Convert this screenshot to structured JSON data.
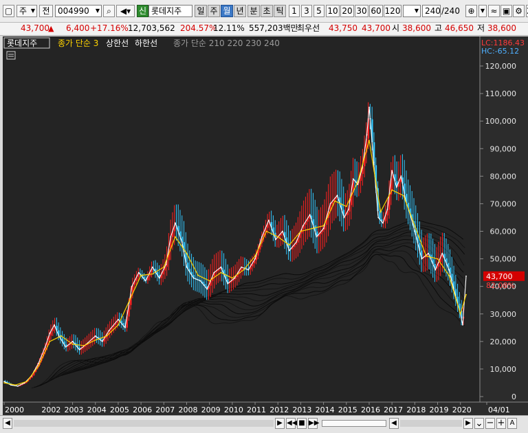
{
  "toolbar": {
    "market_label": "주",
    "market_btn": "전",
    "code": "004990",
    "new_badge": "신",
    "stock_name": "롯데지주",
    "periods": [
      "일",
      "주",
      "월",
      "년",
      "분",
      "초",
      "틱"
    ],
    "selected_period": "월",
    "counts": [
      "1",
      "3",
      "5",
      "10",
      "20",
      "30",
      "60",
      "120"
    ],
    "bar_count": "240",
    "bar_total": "/240",
    "right_partial": "20"
  },
  "quote": {
    "price": "43,700",
    "arrow": "▲",
    "change": "6,400",
    "change_pct": "+17.16%",
    "volume": "12,703,562",
    "volume_ratio": "204.57%",
    "turnover": "12.11%",
    "amount": "557,203백만",
    "best_label": "최우선",
    "best_price": "43,750",
    "ask_price": "43,700",
    "open_label": "시",
    "open": "38,600",
    "high_label": "고",
    "high": "46,650",
    "low_label": "저",
    "low": "38,600"
  },
  "legend": {
    "stock_name": "롯데지주",
    "price_ma": "종가 단순 3",
    "upper": "상한선",
    "lower": "하한선",
    "ma_group": "종가 단순 210 220 230 240"
  },
  "chart_data": {
    "type": "line",
    "title": "롯데지주",
    "x_ticks": [
      "2000",
      "2002",
      "2003",
      "2004",
      "2005",
      "2006",
      "2007",
      "2008",
      "2009",
      "2010",
      "2011",
      "2012",
      "2013",
      "2014",
      "2015",
      "2016",
      "2017",
      "2018",
      "2019",
      "2020",
      "04/01"
    ],
    "y_ticks": [
      0,
      10000,
      20000,
      30000,
      40000,
      50000,
      60000,
      70000,
      80000,
      90000,
      100000,
      110000,
      120000
    ],
    "y_tick_labels": [
      "0",
      "10,000",
      "20,000",
      "30,000",
      "40,000",
      "50,000",
      "60,000",
      "70,000",
      "80,000",
      "90,000",
      "100,000",
      "110,000",
      "120,000"
    ],
    "ylim": [
      0,
      125000
    ],
    "xlim": [
      2000.0,
      2020.25
    ],
    "grid": false,
    "lc_label": "LC:1186.43",
    "hc_label": "HC:-65.12",
    "current_price": "43,700",
    "current_pct": "82.08%",
    "current_value": 43700,
    "series": [
      {
        "name": "종가",
        "x": [
          2000.0,
          2000.3,
          2000.6,
          2000.9,
          2001.2,
          2001.5,
          2001.8,
          2002.0,
          2002.2,
          2002.4,
          2002.7,
          2003.0,
          2003.3,
          2003.6,
          2004.0,
          2004.3,
          2004.6,
          2005.0,
          2005.3,
          2005.6,
          2005.9,
          2006.2,
          2006.5,
          2006.8,
          2007.1,
          2007.3,
          2007.5,
          2007.8,
          2008.0,
          2008.3,
          2008.6,
          2008.9,
          2009.2,
          2009.5,
          2009.8,
          2010.1,
          2010.4,
          2010.7,
          2011.0,
          2011.3,
          2011.6,
          2011.9,
          2012.2,
          2012.5,
          2012.8,
          2013.1,
          2013.4,
          2013.7,
          2014.0,
          2014.3,
          2014.6,
          2014.9,
          2015.1,
          2015.3,
          2015.5,
          2015.7,
          2015.9,
          2016.0,
          2016.2,
          2016.4,
          2016.6,
          2016.8,
          2017.0,
          2017.2,
          2017.4,
          2017.6,
          2017.8,
          2018.0,
          2018.3,
          2018.6,
          2018.9,
          2019.2,
          2019.5,
          2019.8,
          2020.0,
          2020.1,
          2020.25
        ],
        "y": [
          5500,
          4200,
          3800,
          5000,
          7500,
          12000,
          18000,
          23000,
          26000,
          22000,
          18000,
          20000,
          17000,
          19000,
          22000,
          20000,
          24000,
          28000,
          25000,
          40000,
          45000,
          42000,
          47000,
          43000,
          48000,
          58000,
          63000,
          56000,
          47000,
          43000,
          42000,
          39000,
          45000,
          47000,
          41000,
          43000,
          47000,
          46000,
          50000,
          58000,
          64000,
          57000,
          60000,
          53000,
          56000,
          62000,
          66000,
          58000,
          61000,
          70000,
          73000,
          65000,
          68000,
          79000,
          77000,
          83000,
          95000,
          105000,
          85000,
          65000,
          63000,
          68000,
          82000,
          76000,
          80000,
          71000,
          66000,
          60000,
          50000,
          52000,
          46000,
          52000,
          46000,
          36000,
          30000,
          26000,
          43700
        ],
        "color": "#ffffff"
      },
      {
        "name": "종가 단순 3",
        "x": [
          2000.0,
          2000.5,
          2001.0,
          2001.5,
          2002.0,
          2002.5,
          2003.0,
          2003.5,
          2004.0,
          2004.5,
          2005.0,
          2005.5,
          2006.0,
          2006.5,
          2007.0,
          2007.5,
          2008.0,
          2008.5,
          2009.0,
          2009.5,
          2010.0,
          2010.5,
          2011.0,
          2011.5,
          2012.0,
          2012.5,
          2013.0,
          2013.5,
          2014.0,
          2014.5,
          2015.0,
          2015.5,
          2016.0,
          2016.5,
          2017.0,
          2017.5,
          2018.0,
          2018.5,
          2019.0,
          2019.5,
          2020.0,
          2020.25
        ],
        "y": [
          5000,
          4200,
          5500,
          11000,
          20000,
          22000,
          19000,
          18500,
          20500,
          22000,
          26000,
          35000,
          44000,
          44500,
          47000,
          58000,
          52000,
          44000,
          42000,
          45000,
          43000,
          46000,
          51000,
          60000,
          58000,
          55000,
          60000,
          61000,
          62000,
          71000,
          69000,
          78000,
          93000,
          67000,
          75000,
          73000,
          62000,
          51000,
          50000,
          44000,
          30000,
          37000
        ],
        "color": "#ffd400"
      }
    ]
  }
}
